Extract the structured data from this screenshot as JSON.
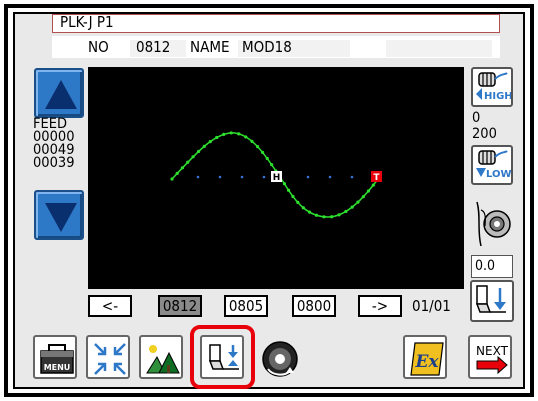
{
  "header": {
    "title": "PLK-J  P1",
    "no_label": "NO",
    "no_value": "0812",
    "name_label": "NAME",
    "name_value": "MOD18"
  },
  "left_panel": {
    "feed_label": "FEED",
    "feed_values": [
      "00000",
      "00049",
      "00039"
    ],
    "up_icon": "triangle-up",
    "down_icon": "triangle-down"
  },
  "right_panel": {
    "high_label": "HIGH",
    "low_label": "LOW",
    "range_top": "0",
    "range_bottom": "200",
    "thread_value": "0.0"
  },
  "canvas": {
    "home_marker": "H",
    "tail_marker": "T"
  },
  "pager": {
    "prev_label": "<-",
    "next_label": "->",
    "pages": [
      "0812",
      "0805",
      "0800"
    ],
    "selected_page": "0812",
    "page_count": "01/01"
  },
  "toolbar": {
    "menu_label": "MENU",
    "ex_label": "Ex",
    "next_label": "NEXT"
  },
  "colors": {
    "stitch": "#2ee02e",
    "baseline": "#3a6fd8",
    "home_marker": "#ffffff",
    "tail_marker": "#e8000b",
    "highlight": "#e8000b",
    "arrow_button": "#2e78c8"
  }
}
